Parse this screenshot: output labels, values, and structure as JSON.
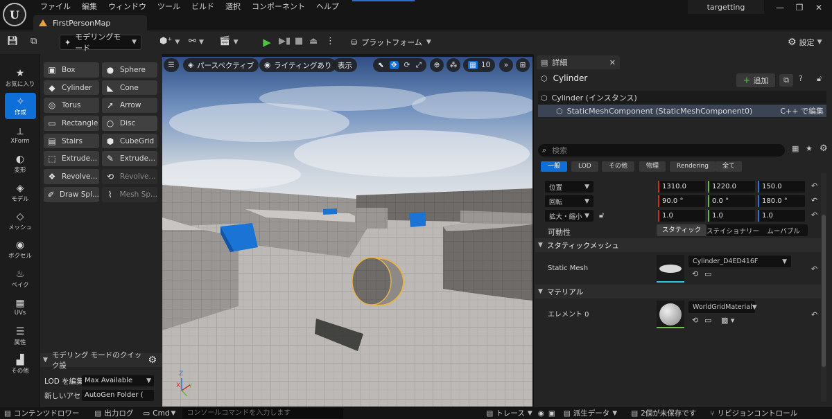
{
  "menu": [
    "ファイル",
    "編集",
    "ウィンドウ",
    "ツール",
    "ビルド",
    "選択",
    "コンポーネント",
    "ヘルプ"
  ],
  "project_name": "targetting",
  "map_tab": "FirstPersonMap",
  "toolbar": {
    "mode_label": "モデリングモード",
    "platform_label": "プラットフォーム",
    "settings_label": "設定"
  },
  "mode_strip": [
    {
      "icon": "★",
      "label": "お気に入り"
    },
    {
      "icon": "✧",
      "label": "作成",
      "active": true
    },
    {
      "icon": "⟂",
      "label": "XForm"
    },
    {
      "icon": "◐",
      "label": "変形"
    },
    {
      "icon": "◈",
      "label": "モデル"
    },
    {
      "icon": "◇",
      "label": "メッシュ"
    },
    {
      "icon": "◉",
      "label": "ボクセル"
    },
    {
      "icon": "♨",
      "label": "ベイク"
    },
    {
      "icon": "▦",
      "label": "UVs"
    },
    {
      "icon": "☰",
      "label": "属性"
    },
    {
      "icon": "▟",
      "label": "その他"
    }
  ],
  "tools": [
    {
      "icon": "▣",
      "label": "Box"
    },
    {
      "icon": "●",
      "label": "Sphere"
    },
    {
      "icon": "◆",
      "label": "Cylinder"
    },
    {
      "icon": "◣",
      "label": "Cone"
    },
    {
      "icon": "◎",
      "label": "Torus"
    },
    {
      "icon": "➚",
      "label": "Arrow"
    },
    {
      "icon": "▭",
      "label": "Rectangle"
    },
    {
      "icon": "○",
      "label": "Disc"
    },
    {
      "icon": "▤",
      "label": "Stairs"
    },
    {
      "icon": "⬢",
      "label": "CubeGrid"
    },
    {
      "icon": "⬚",
      "label": "Extrude..."
    },
    {
      "icon": "✎",
      "label": "Extrude..."
    },
    {
      "icon": "❖",
      "label": "Revolve..."
    },
    {
      "icon": "⟲",
      "label": "Revolve..."
    },
    {
      "icon": "✐",
      "label": "Draw Spl..."
    },
    {
      "icon": "⌇",
      "label": "Mesh Sp..."
    }
  ],
  "quick_settings": {
    "title": "モデリング モードのクイック設",
    "lod_label": "LOD を編集",
    "lod_value": "Max Available",
    "asset_label": "新しいアセ",
    "asset_value": "AutoGen Folder ("
  },
  "viewport": {
    "perspective": "パースペクティブ",
    "lighting": "ライティングあり",
    "show": "表示",
    "grid_snap": "10",
    "axis_x": "X",
    "axis_y": "Y",
    "axis_z": "Z"
  },
  "details": {
    "tab_label": "詳細",
    "actor_name": "Cylinder",
    "add_label": "追加",
    "tree_instance": "Cylinder (インスタンス)",
    "tree_component": "StaticMeshComponent (StaticMeshComponent0)",
    "cpp_edit": "C++ で編集",
    "search_placeholder": "検索",
    "categories": [
      "一般",
      "LOD",
      "その他",
      "物理",
      "Rendering",
      "全て"
    ],
    "transform": [
      {
        "label": "位置",
        "x": "1310.0",
        "y": "1220.0",
        "z": "150.0"
      },
      {
        "label": "回転",
        "x": "90.0 °",
        "y": "0.0 °",
        "z": "180.0 °"
      },
      {
        "label": "拡大・縮小",
        "x": "1.0",
        "y": "1.0",
        "z": "1.0"
      }
    ],
    "mobility_label": "可動性",
    "mobility_options": [
      "スタティック",
      "ステイショナリー",
      "ムーバブル"
    ],
    "static_mesh_section": "スタティックメッシュ",
    "static_mesh_label": "Static Mesh",
    "static_mesh_value": "Cylinder_D4ED416F",
    "material_section": "マテリアル",
    "element_label": "エレメント 0",
    "material_value": "WorldGridMaterial"
  },
  "status": {
    "content_drawer": "コンテンツドロワー",
    "output_log": "出力ログ",
    "cmd": "Cmd",
    "console_placeholder": "コンソールコマンドを入力します",
    "trace": "トレース",
    "derived_data": "派生データ",
    "unsaved": "2個が未保存です",
    "revision": "リビジョンコントロール"
  },
  "colors": {
    "accent": "#0f6fd9",
    "play": "#4fc243",
    "axis_x": "#c8302a",
    "axis_y": "#6fb33a",
    "axis_z": "#2f6fd6"
  }
}
